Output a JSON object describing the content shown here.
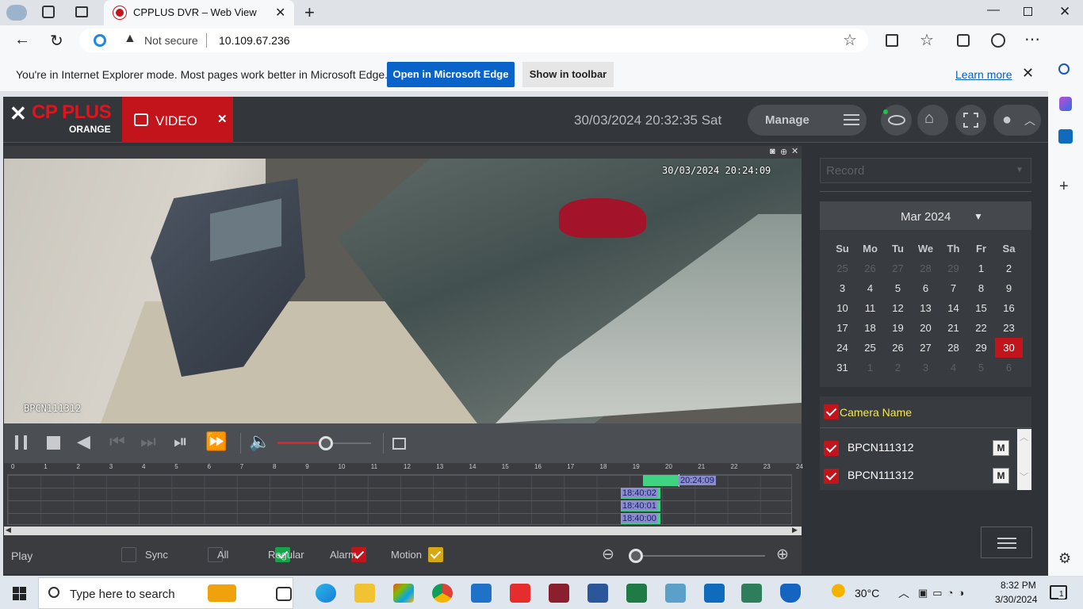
{
  "browser": {
    "tab_title": "CPPLUS DVR – Web View",
    "not_secure": "Not secure",
    "url": "10.109.67.236"
  },
  "ie_mode_bar": {
    "message": "You're in Internet Explorer mode. Most pages work better in Microsoft Edge.",
    "open_edge": "Open in Microsoft Edge",
    "show_toolbar": "Show in toolbar",
    "learn_more": "Learn more"
  },
  "dvr": {
    "logo_line1": "CP PLUS",
    "logo_line2": "ORANGE",
    "video_tab": "VIDEO",
    "datetime": "30/03/2024 20:32:35 Sat",
    "manage": "Manage",
    "video_overlay_time": "30/03/2024 20:24:09",
    "video_overlay_name": "BPCN111312",
    "timeline_hours": [
      "0",
      "1",
      "2",
      "3",
      "4",
      "5",
      "6",
      "7",
      "8",
      "9",
      "10",
      "11",
      "12",
      "13",
      "14",
      "15",
      "16",
      "17",
      "18",
      "19",
      "20",
      "21",
      "22",
      "23",
      "24"
    ],
    "timeline_labels": [
      "20:24:09",
      "18:40:02",
      "18:40:01",
      "18:40:00"
    ],
    "play_label": "Play",
    "filters": [
      {
        "label": "Sync",
        "state": "off"
      },
      {
        "label": "All",
        "state": "off"
      },
      {
        "label": "Regular",
        "state": "on",
        "color": "#17a34a"
      },
      {
        "label": "Alarm",
        "state": "on",
        "color": "#c4141b"
      },
      {
        "label": "Motion",
        "state": "on",
        "color": "#d4a817"
      }
    ],
    "record_select": "Record",
    "calendar": {
      "month": "Mar 2024",
      "weekdays": [
        "Su",
        "Mo",
        "Tu",
        "We",
        "Th",
        "Fr",
        "Sa"
      ],
      "weeks": [
        [
          "25",
          "26",
          "27",
          "28",
          "29",
          "1",
          "2"
        ],
        [
          "3",
          "4",
          "5",
          "6",
          "7",
          "8",
          "9"
        ],
        [
          "10",
          "11",
          "12",
          "13",
          "14",
          "15",
          "16"
        ],
        [
          "17",
          "18",
          "19",
          "20",
          "21",
          "22",
          "23"
        ],
        [
          "24",
          "25",
          "26",
          "27",
          "28",
          "29",
          "30"
        ],
        [
          "31",
          "1",
          "2",
          "3",
          "4",
          "5",
          "6"
        ]
      ],
      "selected": "30"
    },
    "camera_header": "Camera Name",
    "cameras": [
      {
        "name": "BPCN111312",
        "mode": "M"
      },
      {
        "name": "BPCN111312",
        "mode": "M"
      }
    ]
  },
  "taskbar": {
    "search_placeholder": "Type here to search",
    "temperature": "30°C",
    "time": "8:32 PM",
    "date": "3/30/2024",
    "notifications": "1"
  }
}
